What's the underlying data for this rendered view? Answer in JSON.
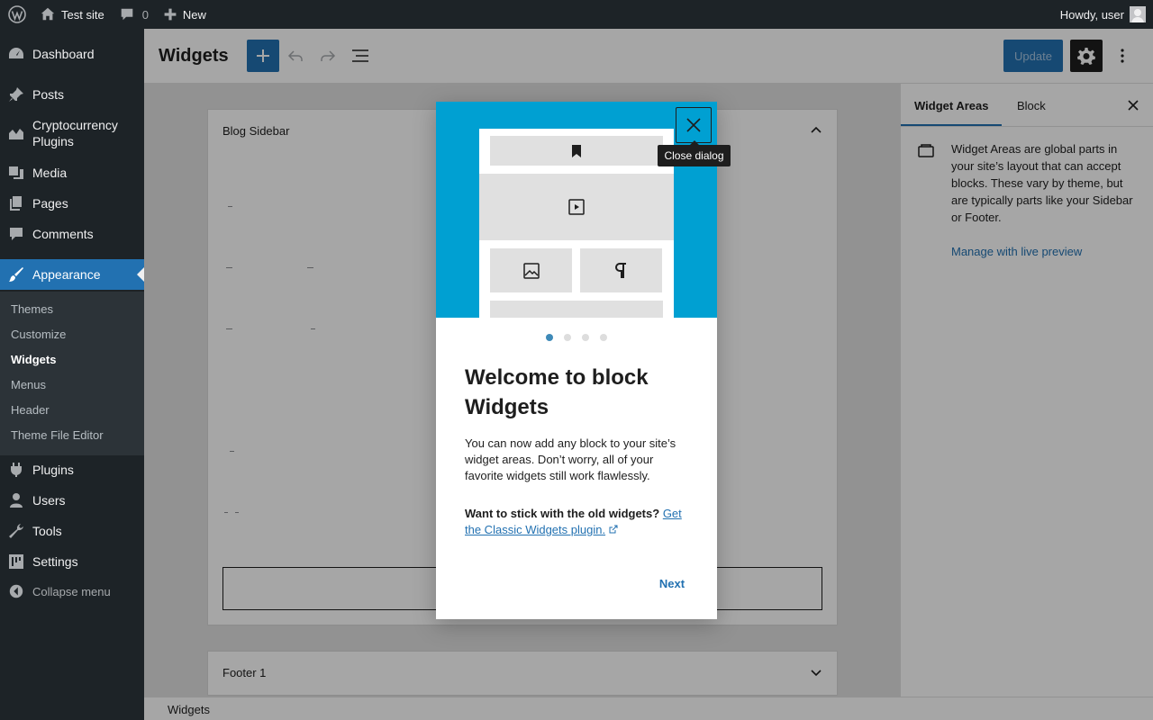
{
  "admin_bar": {
    "site_name": "Test site",
    "comments_count": "0",
    "new_label": "New",
    "greeting": "Howdy, user"
  },
  "sidebar": {
    "items": [
      {
        "label": "Dashboard",
        "icon": "dashboard-icon"
      },
      {
        "label": "Posts",
        "icon": "pin-icon"
      },
      {
        "label": "Cryptocurrency Plugins",
        "icon": "chart-area-icon"
      },
      {
        "label": "Media",
        "icon": "media-icon"
      },
      {
        "label": "Pages",
        "icon": "pages-icon"
      },
      {
        "label": "Comments",
        "icon": "comment-icon"
      },
      {
        "label": "Appearance",
        "icon": "paintbrush-icon"
      },
      {
        "label": "Plugins",
        "icon": "plugin-icon"
      },
      {
        "label": "Users",
        "icon": "user-icon"
      },
      {
        "label": "Tools",
        "icon": "wrench-icon"
      },
      {
        "label": "Settings",
        "icon": "settings-icon"
      }
    ],
    "submenu": [
      "Themes",
      "Customize",
      "Widgets",
      "Menus",
      "Header",
      "Theme File Editor"
    ],
    "submenu_current": "Widgets",
    "collapse_label": "Collapse menu"
  },
  "header": {
    "title": "Widgets",
    "update_label": "Update"
  },
  "canvas": {
    "areas": [
      {
        "title": "Blog Sidebar",
        "expanded": true
      },
      {
        "title": "Footer 1",
        "expanded": false
      }
    ]
  },
  "inspector": {
    "tabs": [
      "Widget Areas",
      "Block"
    ],
    "active_tab": "Widget Areas",
    "description": "Widget Areas are global parts in your site’s layout that can accept blocks. These vary by theme, but are typically parts like your Sidebar or Footer.",
    "link": "Manage with live preview"
  },
  "footer": {
    "breadcrumb": "Widgets"
  },
  "modal": {
    "heading": "Welcome to block Widgets",
    "text": "You can now add any block to your site’s widget areas. Don’t worry, all of your favorite widgets still work flawlessly.",
    "old_question": "Want to stick with the old widgets?",
    "old_link": "Get the Classic Widgets plugin.",
    "next_label": "Next",
    "close_tooltip": "Close dialog",
    "page_total": 4,
    "page_current": 1
  },
  "colors": {
    "admin_dark": "#1d2327",
    "accent": "#2271b1",
    "hero": "#00a0d2"
  }
}
